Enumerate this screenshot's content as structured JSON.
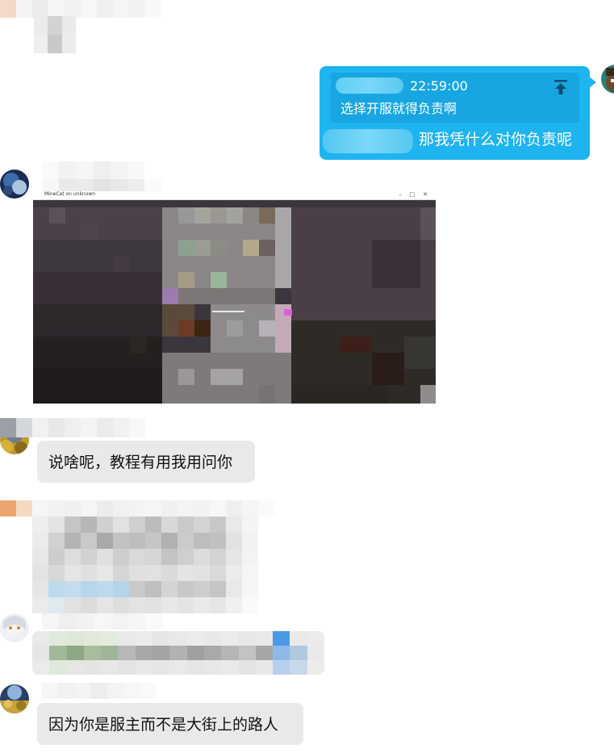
{
  "chat": {
    "quote": {
      "time": "22:59:00",
      "text": "选择开服就得负责啊"
    },
    "my_reply": "那我凭什么对你负责呢",
    "screenshot_window_title": "MineCat on unknown",
    "messages": [
      {
        "text": "说啥呢，教程有用我用问你"
      },
      {
        "text": "因为你是服主而不是大街上的路人"
      }
    ]
  },
  "icons": {
    "quote_jump": "arrow-to-top-icon",
    "window_minimize": "–",
    "window_maximize": "□",
    "window_close": "✕"
  },
  "colors": {
    "self_bubble": "#1eb4f0",
    "other_bubble": "#e9e9e9"
  }
}
